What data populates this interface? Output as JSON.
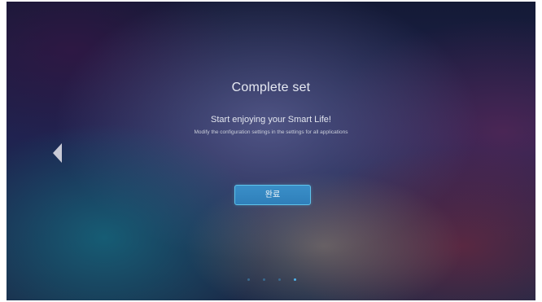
{
  "screen": {
    "title": "Complete set",
    "subtitle": "Start enjoying your Smart Life!",
    "description": "Modify the configuration settings in the settings for all applications"
  },
  "navigation": {
    "prev_icon": "chevron-left-icon"
  },
  "actions": {
    "done_label": "완료"
  },
  "pager": {
    "total_pages": 4,
    "current_page": 4
  },
  "colors": {
    "accent": "#4fb6ee",
    "button_fill": "#2f7fba",
    "button_border": "#5fc3ea"
  }
}
